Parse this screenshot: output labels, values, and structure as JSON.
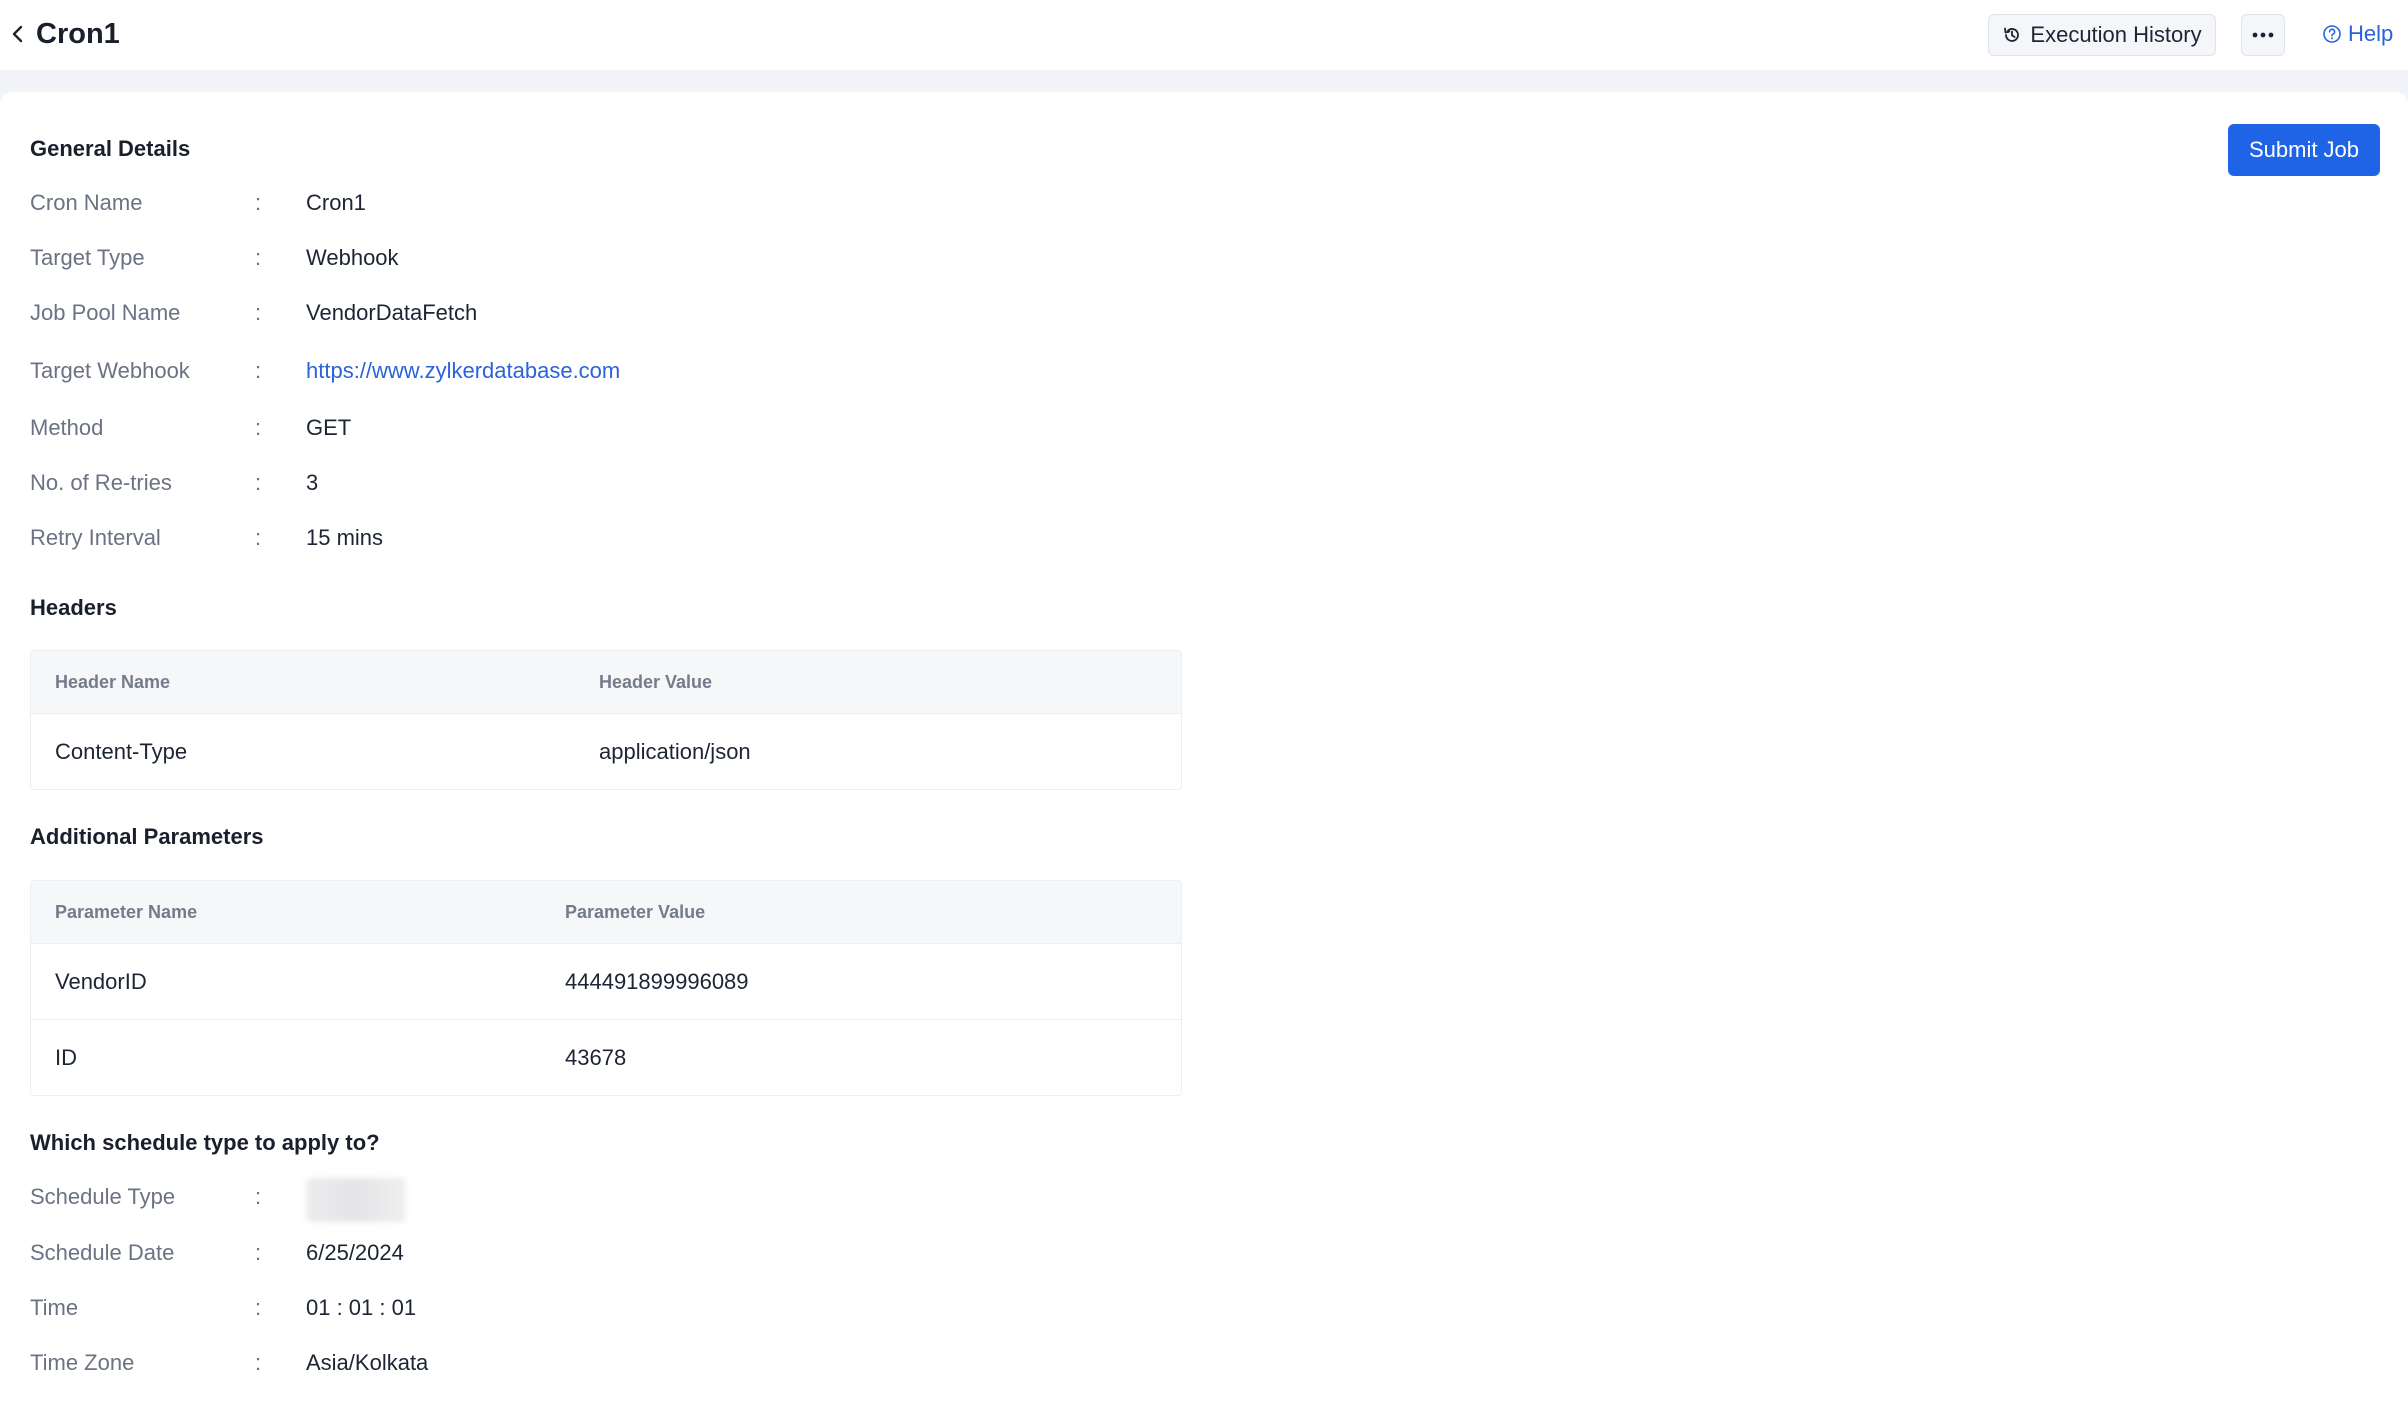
{
  "header": {
    "title": "Cron1",
    "execution_history_label": "Execution History",
    "more_label": "more options",
    "help_label": "Help"
  },
  "actions": {
    "submit_label": "Submit Job"
  },
  "general": {
    "title": "General Details",
    "fields": [
      {
        "label": "Cron Name",
        "value": "Cron1"
      },
      {
        "label": "Target Type",
        "value": "Webhook"
      },
      {
        "label": "Job Pool Name",
        "value": "VendorDataFetch"
      },
      {
        "label": "Target Webhook",
        "value": "https://www.zylkerdatabase.com"
      },
      {
        "label": "Method",
        "value": "GET"
      },
      {
        "label": "No. of Re-tries",
        "value": "3"
      },
      {
        "label": "Retry Interval",
        "value": "15 mins"
      }
    ]
  },
  "headers": {
    "title": "Headers",
    "columns": [
      "Header Name",
      "Header Value"
    ],
    "rows": [
      [
        "Content-Type",
        "application/json"
      ]
    ]
  },
  "params": {
    "title": "Additional Parameters",
    "columns": [
      "Parameter Name",
      "Parameter Value"
    ],
    "rows": [
      [
        "VendorID",
        "444491899996089"
      ],
      [
        "ID",
        "43678"
      ]
    ]
  },
  "schedule": {
    "title": "Which schedule type to apply to?",
    "fields": [
      {
        "label": "Schedule Type",
        "value": ""
      },
      {
        "label": "Schedule Date",
        "value": "6/25/2024"
      },
      {
        "label": "Time",
        "value": "01 : 01 : 01"
      },
      {
        "label": "Time Zone",
        "value": "Asia/Kolkata"
      }
    ]
  },
  "colon": ":",
  "colors": {
    "accent": "#1f63e6",
    "link": "#2b63d9",
    "label": "#6b7283"
  },
  "icons": [
    "chevron-left-icon",
    "history-icon",
    "ellipsis-icon",
    "help-circle-icon"
  ]
}
